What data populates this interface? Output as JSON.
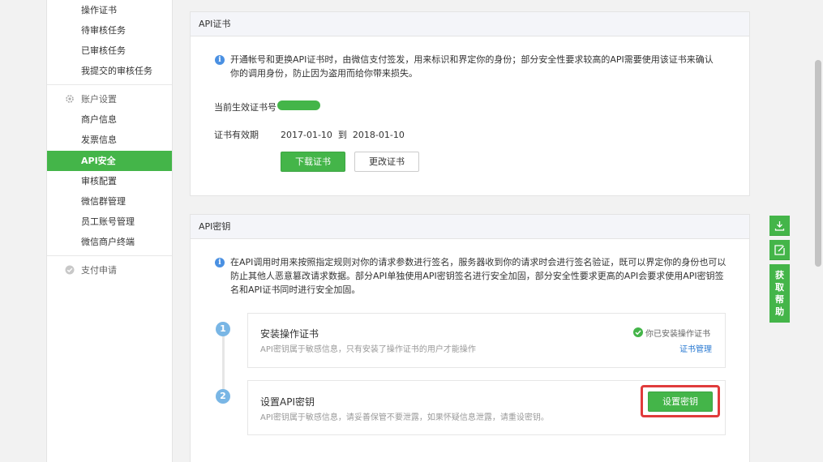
{
  "sidebar": {
    "items_top": [
      "操作证书",
      "待审核任务",
      "已审核任务",
      "我提交的审核任务"
    ],
    "account_section": "账户设置",
    "account_items": [
      "商户信息",
      "发票信息",
      "API安全",
      "审核配置",
      "微信群管理",
      "员工账号管理",
      "微信商户终端"
    ],
    "pay_section": "支付申请"
  },
  "cert_panel": {
    "title": "API证书",
    "info": "开通帐号和更换API证书时，由微信支付签发，用来标识和界定你的身份；部分安全性要求较高的API需要使用该证书来确认你的调用身份，防止因为盗用而给你带来损失。",
    "serial_label": "当前生效证书号",
    "validity_label": "证书有效期",
    "validity_value": "2017-01-10  到  2018-01-10",
    "download_btn": "下载证书",
    "change_btn": "更改证书"
  },
  "key_panel": {
    "title": "API密钥",
    "info": "在API调用时用来按照指定规则对你的请求参数进行签名，服务器收到你的请求时会进行签名验证，既可以界定你的身份也可以防止其他人恶意篡改请求数据。部分API单独使用API密钥签名进行安全加固，部分安全性要求更高的API会要求使用API密钥签名和API证书同时进行安全加固。",
    "steps": [
      {
        "num": "1",
        "title": "安装操作证书",
        "desc": "API密钥属于敏感信息，只有安装了操作证书的用户才能操作",
        "status": "你已安装操作证书",
        "link": "证书管理"
      },
      {
        "num": "2",
        "title": "设置API密钥",
        "desc": "API密钥属于敏感信息，请妥善保管不要泄露，如果怀疑信息泄露，请重设密钥。",
        "button": "设置密钥"
      }
    ]
  },
  "float_bar": {
    "help_chars": [
      "获",
      "取",
      "帮",
      "助"
    ]
  },
  "colors": {
    "accent": "#44b549",
    "step_blue": "#79b6e5",
    "link_blue": "#2a7ad2",
    "highlight_red": "#e03b3b"
  }
}
